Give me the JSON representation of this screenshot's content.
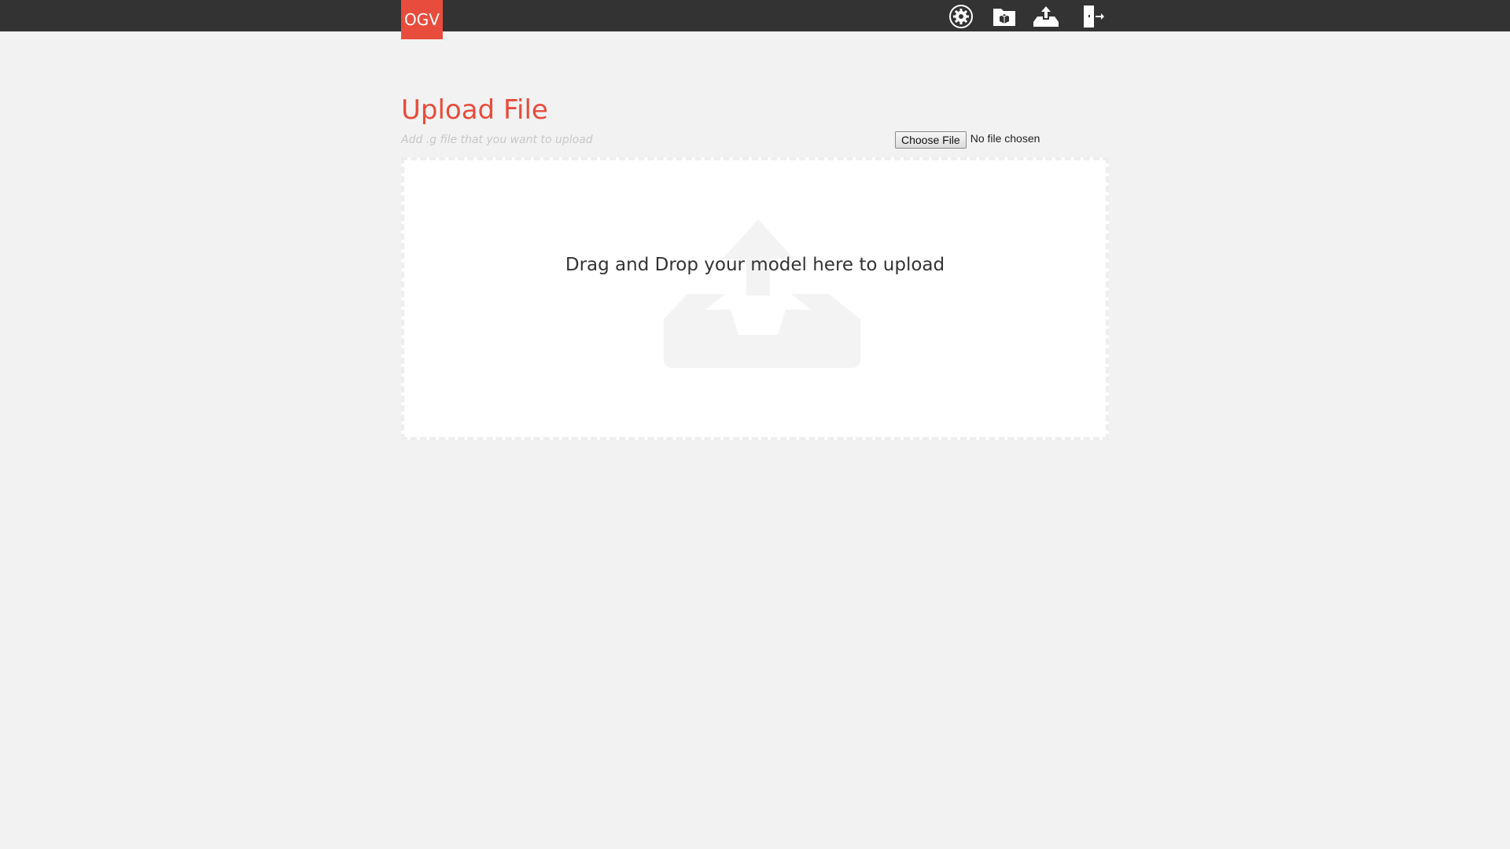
{
  "topbar": {
    "logo_text": "OGV",
    "nav_icons": [
      "settings-icon",
      "models-folder-icon",
      "upload-icon",
      "logout-icon"
    ]
  },
  "main": {
    "title": "Upload File",
    "subtitle": "Add .g file that you want to upload",
    "file_input": {
      "button_label": "Choose File",
      "status": "No file chosen"
    },
    "dropzone": {
      "text": "Drag and Drop your model here to upload",
      "icon": "upload-tray-icon"
    }
  },
  "colors": {
    "accent": "#e74c3c",
    "topbar": "#333333",
    "background": "#f2f2f2"
  }
}
